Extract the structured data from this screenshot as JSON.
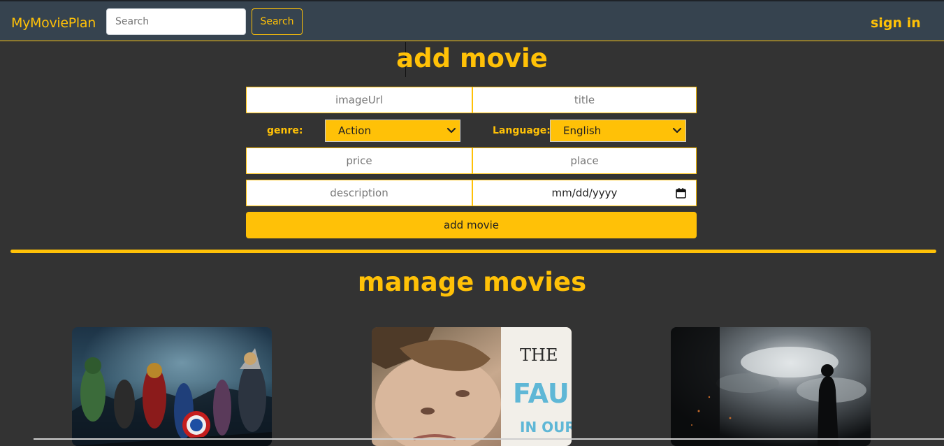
{
  "navbar": {
    "brand": "MyMoviePlan",
    "search_placeholder": "Search",
    "search_button": "Search",
    "sign_in": "sign in"
  },
  "add_form": {
    "heading": "add movie",
    "image_url_placeholder": "imageUrl",
    "title_placeholder": "title",
    "genre_label": "genre:",
    "genre_selected": "Action",
    "language_label": "Language:",
    "language_selected": "English",
    "price_placeholder": "price",
    "place_placeholder": "place",
    "description_placeholder": "description",
    "date_placeholder": "mm/dd/yyyy",
    "submit_label": "add movie"
  },
  "manage": {
    "heading": "manage movies",
    "movies": [
      {
        "poster": "superhero-team-poster"
      },
      {
        "poster": "romance-drama-poster",
        "poster_text": [
          "THE",
          "FAULT",
          "IN OUR"
        ]
      },
      {
        "poster": "dark-sky-action-poster"
      }
    ]
  },
  "colors": {
    "accent": "#ffc107",
    "navbar_bg": "#36434f",
    "page_bg": "#333333"
  }
}
